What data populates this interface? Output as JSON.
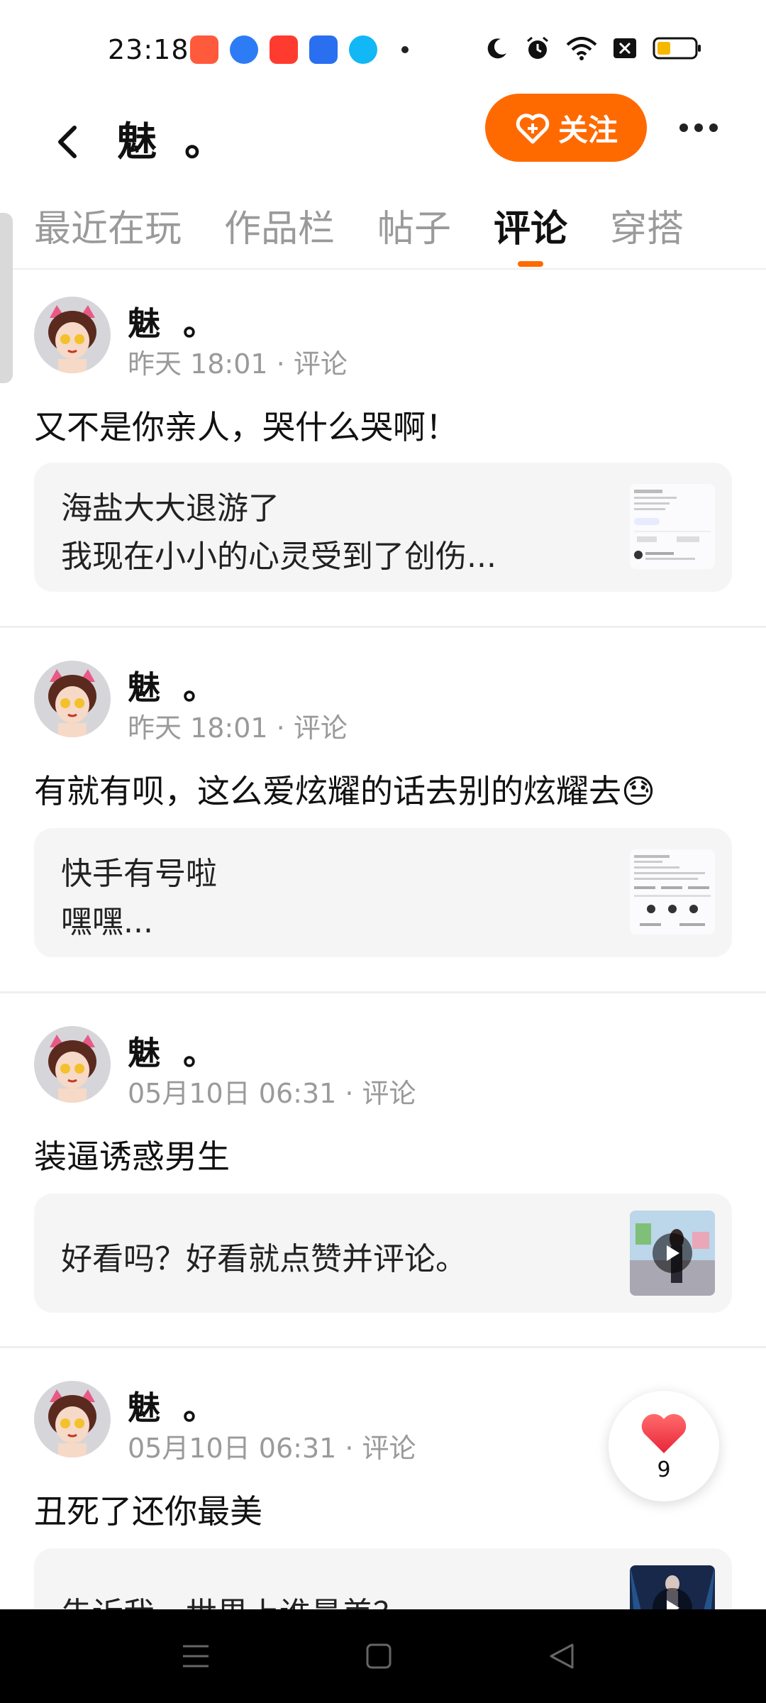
{
  "status_bar": {
    "time": "23:18",
    "app_icons": [
      {
        "name": "app-icon-orange",
        "color": "#ff5a3c"
      },
      {
        "name": "app-icon-blue",
        "color": "#2d7cf6"
      },
      {
        "name": "app-icon-video",
        "color": "#ff3b30"
      },
      {
        "name": "app-icon-bluebag",
        "color": "#2a6ff0"
      },
      {
        "name": "app-icon-qq",
        "color": "#12b7f5"
      }
    ]
  },
  "header": {
    "title": "魅  。",
    "follow_label": "关注",
    "accent_color": "#ff6a00"
  },
  "tabs": [
    {
      "label": "最近在玩",
      "active": false
    },
    {
      "label": "作品栏",
      "active": false
    },
    {
      "label": "帖子",
      "active": false
    },
    {
      "label": "评论",
      "active": true
    },
    {
      "label": "穿搭",
      "active": false
    }
  ],
  "posts": [
    {
      "author": "魅  。",
      "meta": "昨天 18:01 · 评论",
      "text": "又不是你亲人，哭什么哭啊！",
      "quote_lines": [
        "海盐大大退游了",
        "我现在小小的心灵受到了创伤..."
      ],
      "thumb": "document"
    },
    {
      "author": "魅  。",
      "meta": "昨天 18:01 · 评论",
      "text": "有就有呗，这么爱炫耀的话去别的炫耀去😓",
      "quote_lines": [
        "快手有号啦",
        "嘿嘿..."
      ],
      "thumb": "document"
    },
    {
      "author": "魅  。",
      "meta": "05月10日 06:31 · 评论",
      "text": "装逼诱惑男生",
      "quote_lines": [
        "好看吗？好看就点赞并评论。"
      ],
      "thumb": "video"
    },
    {
      "author": "魅  。",
      "meta": "05月10日 06:31 · 评论",
      "text": "丑死了还你最美",
      "quote_lines": [
        "告诉我，世界上谁最美？"
      ],
      "thumb": "video"
    }
  ],
  "like_fab": {
    "count": "9"
  }
}
